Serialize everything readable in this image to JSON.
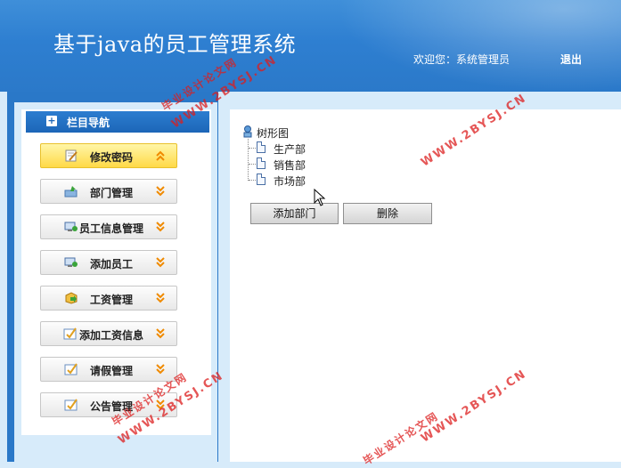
{
  "header": {
    "title": "基于java的员工管理系统",
    "welcome": "欢迎您：系统管理员",
    "logout": "退出"
  },
  "nav": {
    "header_label": "栏目导航",
    "header_icon": "+",
    "items": [
      {
        "label": "修改密码",
        "icon": "edit-note-icon",
        "active": true
      },
      {
        "label": "部门管理",
        "icon": "folder-up-icon",
        "active": false
      },
      {
        "label": "员工信息管理",
        "icon": "user-computer-icon",
        "active": false
      },
      {
        "label": "添加员工",
        "icon": "add-user-icon",
        "active": false
      },
      {
        "label": "工资管理",
        "icon": "package-arrow-icon",
        "active": false
      },
      {
        "label": "添加工资信息",
        "icon": "check-note-icon",
        "active": false
      },
      {
        "label": "请假管理",
        "icon": "check-note-icon",
        "active": false
      },
      {
        "label": "公告管理",
        "icon": "check-note-icon",
        "active": false
      }
    ]
  },
  "tree": {
    "root": "树形图",
    "nodes": [
      "生产部",
      "销售部",
      "市场部"
    ]
  },
  "actions": {
    "add": "添加部门",
    "delete": "删除"
  },
  "watermarks": {
    "url": "WWW.2BYSJ.CN",
    "site": "毕业设计论文网"
  },
  "colors": {
    "header_blue": "#2e7fd1",
    "active_yellow": "#ffd947",
    "chevron_orange": "#f08a00",
    "watermark_red": "#dc1e1e"
  }
}
